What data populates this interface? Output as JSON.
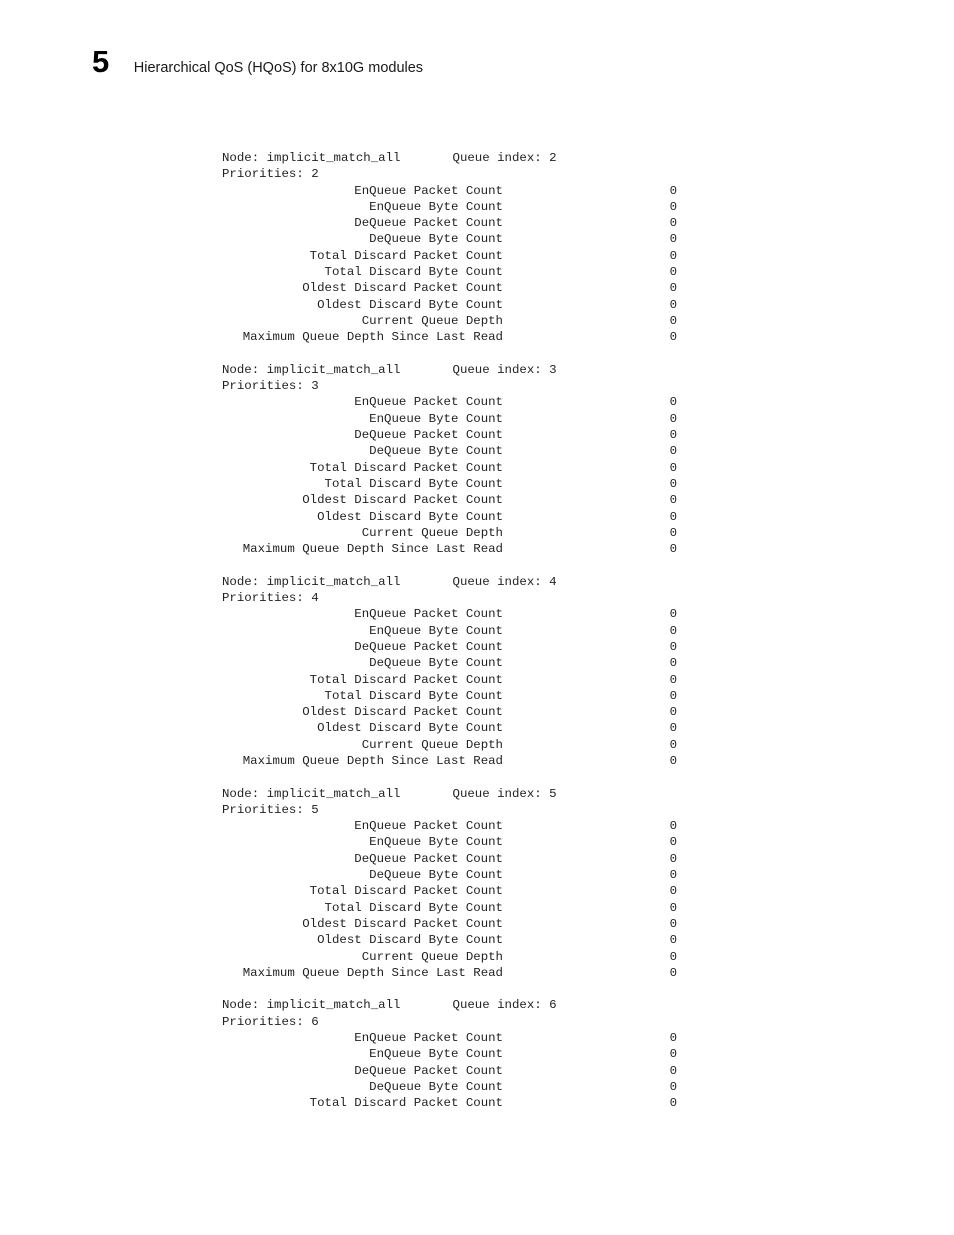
{
  "header": {
    "chapter_number": "5",
    "chapter_title": "Hierarchical QoS (HQoS) for 8x10G modules"
  },
  "cli_output": {
    "node_label": "Node:",
    "node_name": "implicit_match_all",
    "queue_index_label": "Queue index:",
    "priorities_label": "Priorities:",
    "stat_labels": [
      "EnQueue Packet Count",
      "EnQueue Byte Count",
      "DeQueue Packet Count",
      "DeQueue Byte Count",
      "Total Discard Packet Count",
      "Total Discard Byte Count",
      "Oldest Discard Packet Count",
      "Oldest Discard Byte Count",
      "Current Queue Depth",
      "Maximum Queue Depth Since Last Read"
    ],
    "blocks": [
      {
        "header_line": "Node: implicit_match_all       Queue index: 2",
        "priorities_line": "Priorities: 2",
        "queue_index": "2",
        "priorities": "2",
        "stats": [
          {
            "label": "EnQueue Packet Count",
            "value": "0"
          },
          {
            "label": "EnQueue Byte Count",
            "value": "0"
          },
          {
            "label": "DeQueue Packet Count",
            "value": "0"
          },
          {
            "label": "DeQueue Byte Count",
            "value": "0"
          },
          {
            "label": "Total Discard Packet Count",
            "value": "0"
          },
          {
            "label": "Total Discard Byte Count",
            "value": "0"
          },
          {
            "label": "Oldest Discard Packet Count",
            "value": "0"
          },
          {
            "label": "Oldest Discard Byte Count",
            "value": "0"
          },
          {
            "label": "Current Queue Depth",
            "value": "0"
          },
          {
            "label": "Maximum Queue Depth Since Last Read",
            "value": "0"
          }
        ]
      },
      {
        "header_line": "Node: implicit_match_all       Queue index: 3",
        "priorities_line": "Priorities: 3",
        "queue_index": "3",
        "priorities": "3",
        "stats": [
          {
            "label": "EnQueue Packet Count",
            "value": "0"
          },
          {
            "label": "EnQueue Byte Count",
            "value": "0"
          },
          {
            "label": "DeQueue Packet Count",
            "value": "0"
          },
          {
            "label": "DeQueue Byte Count",
            "value": "0"
          },
          {
            "label": "Total Discard Packet Count",
            "value": "0"
          },
          {
            "label": "Total Discard Byte Count",
            "value": "0"
          },
          {
            "label": "Oldest Discard Packet Count",
            "value": "0"
          },
          {
            "label": "Oldest Discard Byte Count",
            "value": "0"
          },
          {
            "label": "Current Queue Depth",
            "value": "0"
          },
          {
            "label": "Maximum Queue Depth Since Last Read",
            "value": "0"
          }
        ]
      },
      {
        "header_line": "Node: implicit_match_all       Queue index: 4",
        "priorities_line": "Priorities: 4",
        "queue_index": "4",
        "priorities": "4",
        "stats": [
          {
            "label": "EnQueue Packet Count",
            "value": "0"
          },
          {
            "label": "EnQueue Byte Count",
            "value": "0"
          },
          {
            "label": "DeQueue Packet Count",
            "value": "0"
          },
          {
            "label": "DeQueue Byte Count",
            "value": "0"
          },
          {
            "label": "Total Discard Packet Count",
            "value": "0"
          },
          {
            "label": "Total Discard Byte Count",
            "value": "0"
          },
          {
            "label": "Oldest Discard Packet Count",
            "value": "0"
          },
          {
            "label": "Oldest Discard Byte Count",
            "value": "0"
          },
          {
            "label": "Current Queue Depth",
            "value": "0"
          },
          {
            "label": "Maximum Queue Depth Since Last Read",
            "value": "0"
          }
        ]
      },
      {
        "header_line": "Node: implicit_match_all       Queue index: 5",
        "priorities_line": "Priorities: 5",
        "queue_index": "5",
        "priorities": "5",
        "stats": [
          {
            "label": "EnQueue Packet Count",
            "value": "0"
          },
          {
            "label": "EnQueue Byte Count",
            "value": "0"
          },
          {
            "label": "DeQueue Packet Count",
            "value": "0"
          },
          {
            "label": "DeQueue Byte Count",
            "value": "0"
          },
          {
            "label": "Total Discard Packet Count",
            "value": "0"
          },
          {
            "label": "Total Discard Byte Count",
            "value": "0"
          },
          {
            "label": "Oldest Discard Packet Count",
            "value": "0"
          },
          {
            "label": "Oldest Discard Byte Count",
            "value": "0"
          },
          {
            "label": "Current Queue Depth",
            "value": "0"
          },
          {
            "label": "Maximum Queue Depth Since Last Read",
            "value": "0"
          }
        ]
      },
      {
        "header_line": "Node: implicit_match_all       Queue index: 6",
        "priorities_line": "Priorities: 6",
        "queue_index": "6",
        "priorities": "6",
        "stats": [
          {
            "label": "EnQueue Packet Count",
            "value": "0"
          },
          {
            "label": "EnQueue Byte Count",
            "value": "0"
          },
          {
            "label": "DeQueue Packet Count",
            "value": "0"
          },
          {
            "label": "DeQueue Byte Count",
            "value": "0"
          },
          {
            "label": "Total Discard Packet Count",
            "value": "0"
          }
        ]
      }
    ]
  }
}
